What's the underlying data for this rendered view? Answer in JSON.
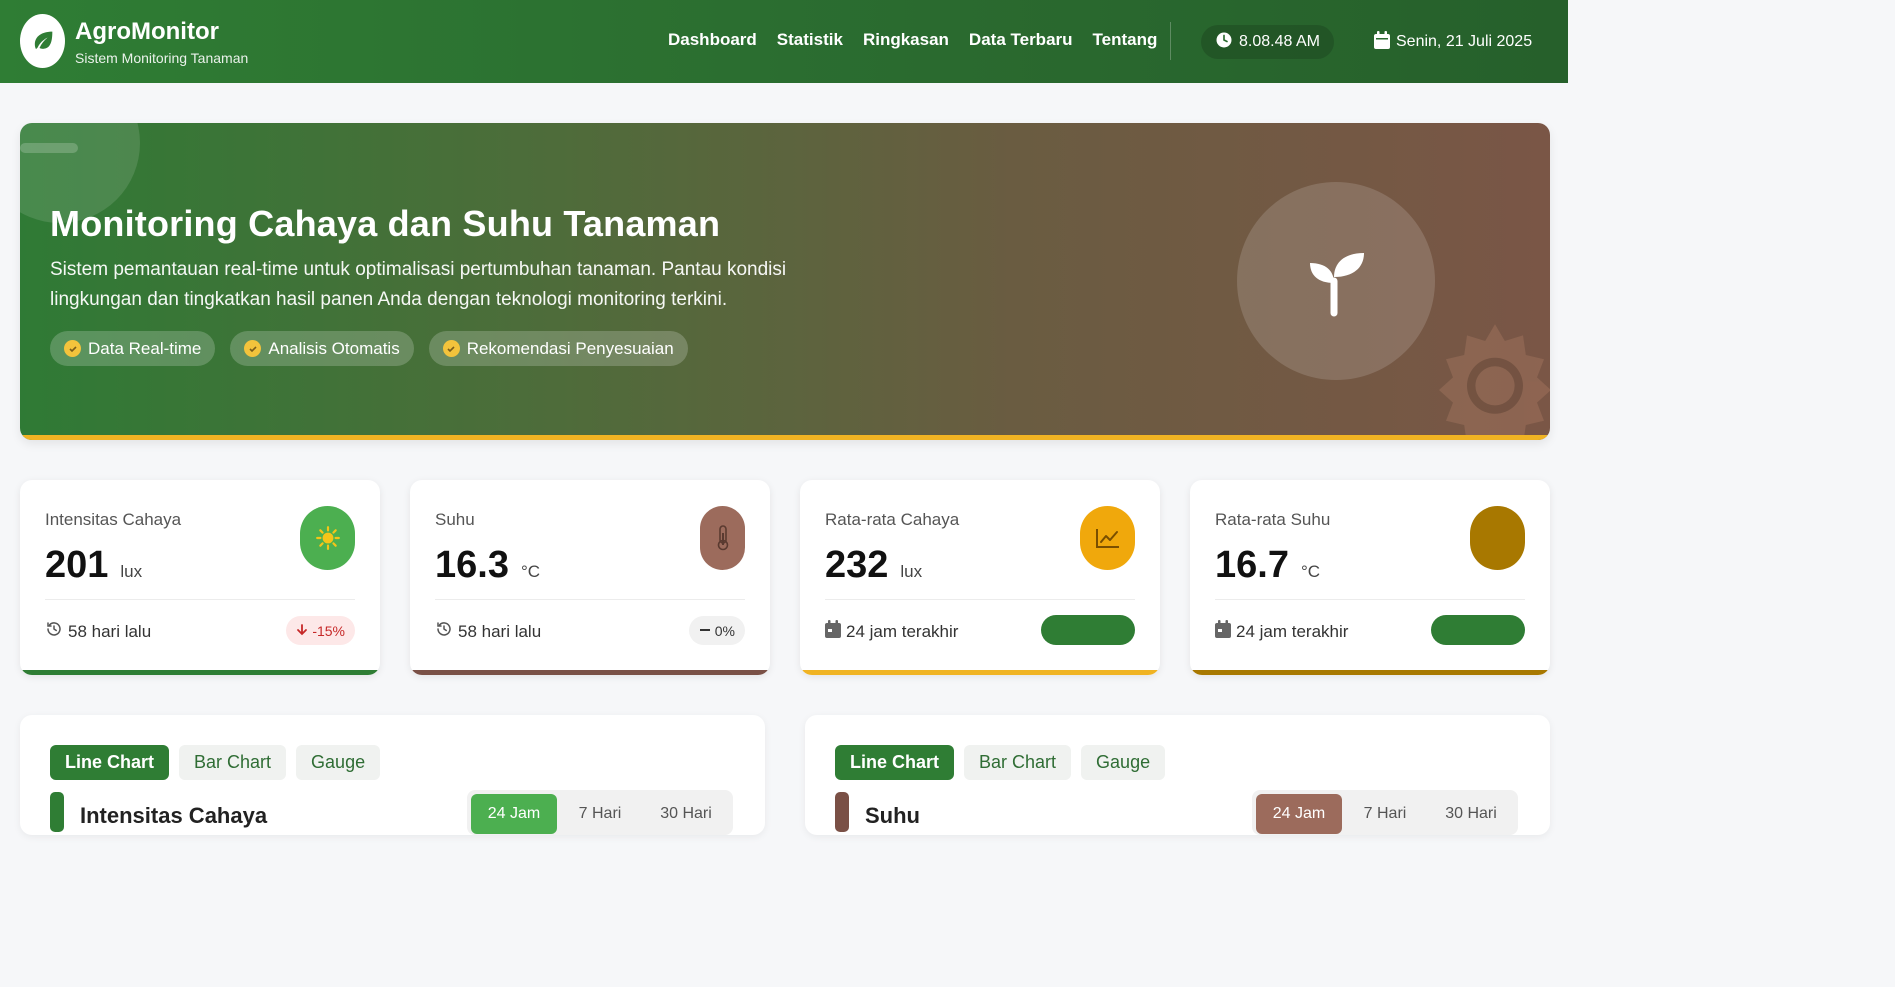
{
  "header": {
    "brand_title": "AgroMonitor",
    "brand_subtitle": "Sistem Monitoring Tanaman",
    "nav": [
      "Dashboard",
      "Statistik",
      "Ringkasan",
      "Data Terbaru",
      "Tentang"
    ],
    "time": "8.08.48 AM",
    "date": "Senin, 21 Juli 2025"
  },
  "hero": {
    "title": "Monitoring Cahaya dan Suhu Tanaman",
    "description": "Sistem pemantauan real-time untuk optimalisasi pertumbuhan tanaman. Pantau kondisi lingkungan dan tingkatkan hasil panen Anda dengan teknologi monitoring terkini.",
    "chips": [
      "Data Real-time",
      "Analisis Otomatis",
      "Rekomendasi Penyesuaian"
    ]
  },
  "cards": [
    {
      "label": "Intensitas Cahaya",
      "value": "201",
      "unit": "lux",
      "footer": "58 hari lalu",
      "badge": "-15%",
      "icon": "sun-icon",
      "color": "#4caf50",
      "accent": "#2f7d34"
    },
    {
      "label": "Suhu",
      "value": "16.3",
      "unit": "°C",
      "footer": "58 hari lalu",
      "badge": "0%",
      "icon": "thermometer-icon",
      "color": "#9c6b5c",
      "accent": "#7a5046"
    },
    {
      "label": "Rata-rata Cahaya",
      "value": "232",
      "unit": "lux",
      "footer": "24 jam terakhir",
      "icon": "chart-line-icon",
      "color": "#f0a80c",
      "accent": "#f0b323"
    },
    {
      "label": "Rata-rata Suhu",
      "value": "16.7",
      "unit": "°C",
      "footer": "24 jam terakhir",
      "icon": "thermometer-icon",
      "color": "#a87800",
      "accent": "#a87800"
    }
  ],
  "panels": [
    {
      "tabs": [
        "Line Chart",
        "Bar Chart",
        "Gauge"
      ],
      "title": "Intensitas Cahaya",
      "ranges": [
        "24 Jam",
        "7 Hari",
        "30 Hari"
      ],
      "accent": "#2f7d34",
      "range_active": "#4caf50"
    },
    {
      "tabs": [
        "Line Chart",
        "Bar Chart",
        "Gauge"
      ],
      "title": "Suhu",
      "ranges": [
        "24 Jam",
        "7 Hari",
        "30 Hari"
      ],
      "accent": "#7a5046",
      "range_active": "#9c6b5c"
    }
  ]
}
